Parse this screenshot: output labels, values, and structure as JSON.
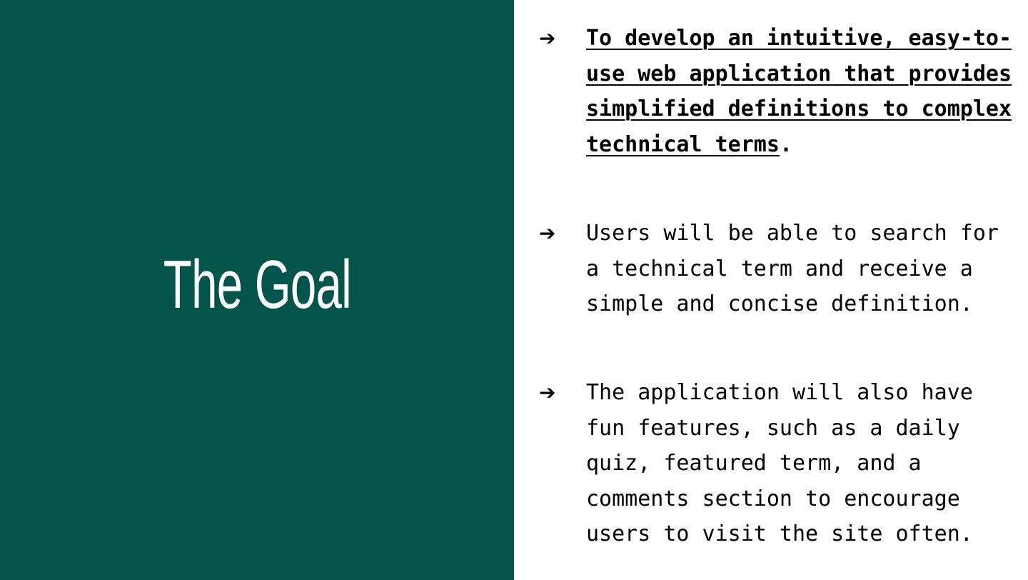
{
  "colors": {
    "left_panel_bg": "#03544a",
    "text": "#000000",
    "title": "#ffffff"
  },
  "title": "The Goal",
  "bullets": [
    {
      "icon": "arrow-right-icon",
      "underlined_text": "To develop an intuitive, easy-to-use web application that provides simplified definitions to complex technical terms",
      "trailing_text": "."
    },
    {
      "icon": "arrow-right-icon",
      "text": "Users will be able to search for a technical term and receive a simple and concise definition."
    },
    {
      "icon": "arrow-right-icon",
      "text": "The application will also have fun features, such as a daily quiz, featured term, and a comments section to encourage users to visit the site often."
    }
  ]
}
